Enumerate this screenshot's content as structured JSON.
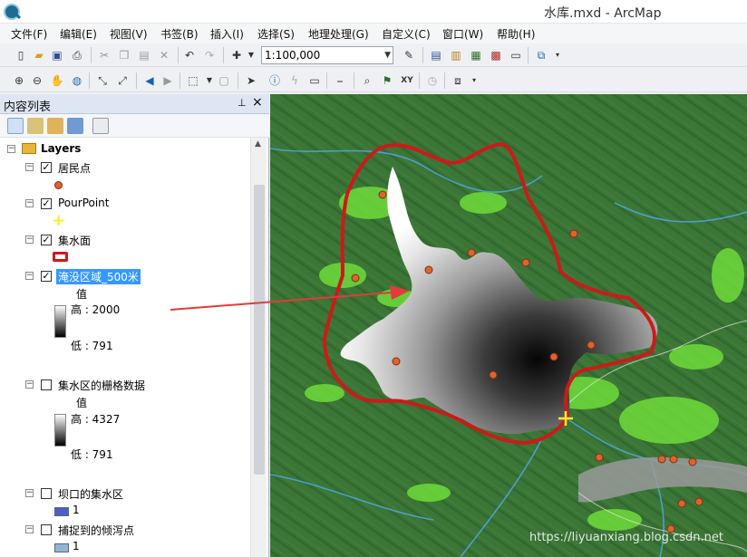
{
  "window": {
    "title": "水库.mxd - ArcMap"
  },
  "menu": [
    "文件(F)",
    "编辑(E)",
    "视图(V)",
    "书签(B)",
    "插入(I)",
    "选择(S)",
    "地理处理(G)",
    "自定义(C)",
    "窗口(W)",
    "帮助(H)"
  ],
  "toolbar": {
    "scale": "1:100,000"
  },
  "toc": {
    "title": "内容列表",
    "pin": "ᵖ",
    "close": "×",
    "root": "Layers",
    "layers": [
      {
        "label": "居民点",
        "checked": true
      },
      {
        "label": "PourPoint",
        "checked": true
      },
      {
        "label": "集水面",
        "checked": true
      },
      {
        "label": "淹没区域_500米",
        "checked": true,
        "value_title": "值",
        "high": "高 : 2000",
        "low": "低 : 791"
      },
      {
        "label": "集水区的栅格数据",
        "checked": false,
        "value_title": "值",
        "high": "高 : 4327",
        "low": "低 : 791"
      },
      {
        "label": "坝口的集水区",
        "checked": false,
        "class_value": "1"
      },
      {
        "label": "捕捉到的倾泻点",
        "checked": false,
        "class_value": "1"
      }
    ]
  },
  "colors": {
    "terrain": "#3f7a3a",
    "boundary": "#cc1a1a",
    "settlement": "#e2622b",
    "pour_point": "#ffee22",
    "arrow": "#e23b3b",
    "basin_swatch": "#4a5fc9",
    "pour_swatch": "#8fb6d6"
  },
  "map": {
    "watermark": "https://liyuanxiang.blog.csdn.net"
  }
}
